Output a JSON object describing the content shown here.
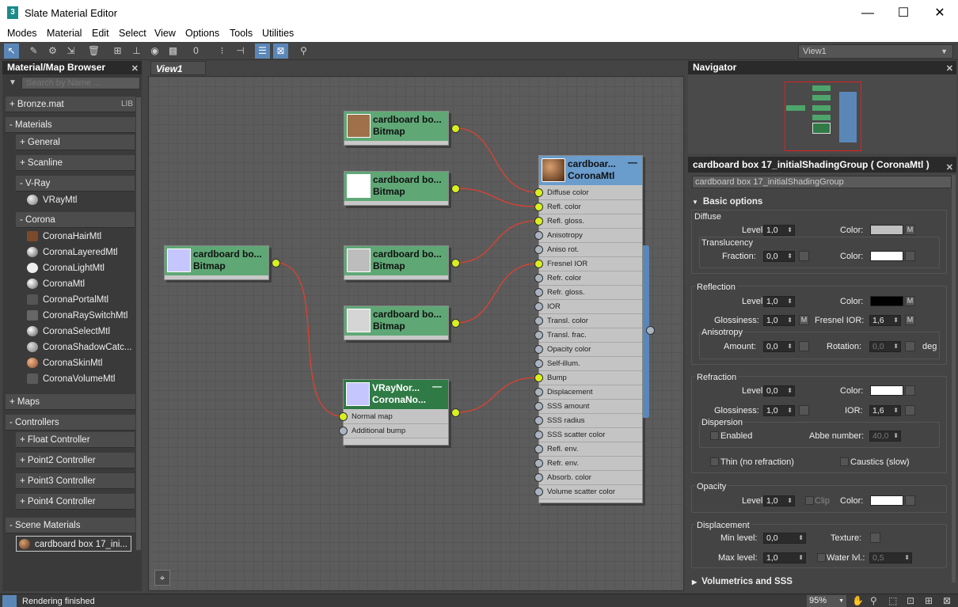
{
  "window": {
    "title": "Slate Material Editor",
    "icon": "3"
  },
  "menu": [
    "Modes",
    "Material",
    "Edit",
    "Select",
    "View",
    "Options",
    "Tools",
    "Utilities"
  ],
  "view_selector": "View1",
  "browser": {
    "title": "Material/Map Browser",
    "search_placeholder": "Search by Name ...",
    "bronze": "+ Bronze.mat",
    "bronze_tag": "LIB",
    "materials": "- Materials",
    "general": "+ General",
    "scanline": "+ Scanline",
    "vray": "- V-Ray",
    "vraymtl": "VRayMtl",
    "corona": "- Corona",
    "corona_items": [
      "CoronaHairMtl",
      "CoronaLayeredMtl",
      "CoronaLightMtl",
      "CoronaMtl",
      "CoronaPortalMtl",
      "CoronaRaySwitchMtl",
      "CoronaSelectMtl",
      "CoronaShadowCatc...",
      "CoronaSkinMtl",
      "CoronaVolumeMtl"
    ],
    "maps": "+ Maps",
    "controllers": "- Controllers",
    "controller_items": [
      "+ Float Controller",
      "+ Point2 Controller",
      "+ Point3 Controller",
      "+ Point4 Controller"
    ],
    "scene_materials": "- Scene Materials",
    "scene_item": "cardboard box 17_ini..."
  },
  "view_tab": "View1",
  "nodes": {
    "bitmap_title": "cardboard bo...",
    "bitmap_type": "Bitmap",
    "vraynormal_title": "VRayNor...",
    "vraynormal_type": "CoronaNo...",
    "vraynormal_slots": [
      "Normal map",
      "Additional bump"
    ],
    "corona_title": "cardboar...",
    "corona_type": "CoronaMtl",
    "corona_slots": [
      "Diffuse color",
      "Refl. color",
      "Refl. gloss.",
      "Anisotropy",
      "Aniso rot.",
      "Fresnel IOR",
      "Refr. color",
      "Refr. gloss.",
      "IOR",
      "Transl. color",
      "Transl. frac.",
      "Opacity color",
      "Self-illum.",
      "Bump",
      "Displacement",
      "SSS amount",
      "SSS radius",
      "SSS scatter color",
      "Refl. env.",
      "Refr. env.",
      "Absorb. color",
      "Volume scatter color"
    ]
  },
  "navigator": {
    "title": "Navigator"
  },
  "props": {
    "title": "cardboard box 17_initialShadingGroup  ( CoronaMtl )",
    "name_field": "cardboard box 17_initialShadingGroup",
    "rollout": "Basic options",
    "diffuse": {
      "label": "Diffuse",
      "level_label": "Level:",
      "level": "1,0",
      "color_label": "Color:",
      "color": "#c0c0c0",
      "m": "M"
    },
    "translucency": {
      "label": "Translucency",
      "fraction_label": "Fraction:",
      "fraction": "0,0",
      "color_label": "Color:",
      "color": "#ffffff"
    },
    "reflection": {
      "label": "Reflection",
      "level_label": "Level:",
      "level": "1,0",
      "color_label": "Color:",
      "color": "#000000",
      "m": "M",
      "gloss_label": "Glossiness:",
      "gloss": "1,0",
      "fresnel_label": "Fresnel IOR:",
      "fresnel": "1,6"
    },
    "anisotropy": {
      "label": "Anisotropy",
      "amount_label": "Amount:",
      "amount": "0,0",
      "rotation_label": "Rotation:",
      "rotation": "0,0",
      "unit": "deg"
    },
    "refraction": {
      "label": "Refraction",
      "level_label": "Level:",
      "level": "0,0",
      "color_label": "Color:",
      "color": "#ffffff",
      "gloss_label": "Glossiness:",
      "gloss": "1,0",
      "ior_label": "IOR:",
      "ior": "1,6"
    },
    "dispersion": {
      "label": "Dispersion",
      "enabled": "Enabled",
      "abbe_label": "Abbe number:",
      "abbe": "40,0"
    },
    "thin": "Thin (no refraction)",
    "caustics": "Caustics (slow)",
    "opacity": {
      "label": "Opacity",
      "level_label": "Level:",
      "level": "1,0",
      "clip": "Clip",
      "color_label": "Color:",
      "color": "#ffffff"
    },
    "displacement": {
      "label": "Displacement",
      "min_label": "Min level:",
      "min": "0,0",
      "texture_label": "Texture:",
      "max_label": "Max level:",
      "max": "1,0",
      "water_label": "Water lvl.:",
      "water": "0,5"
    },
    "volumetrics": "Volumetrics and SSS"
  },
  "status": {
    "text": "Rendering finished",
    "zoom": "95%"
  },
  "colors": {
    "accent": "#5b87b8",
    "node_green": "#5fa876",
    "corona_head": "#6a9ccc",
    "wire": "#e04030",
    "port_active": "#d8f020"
  }
}
